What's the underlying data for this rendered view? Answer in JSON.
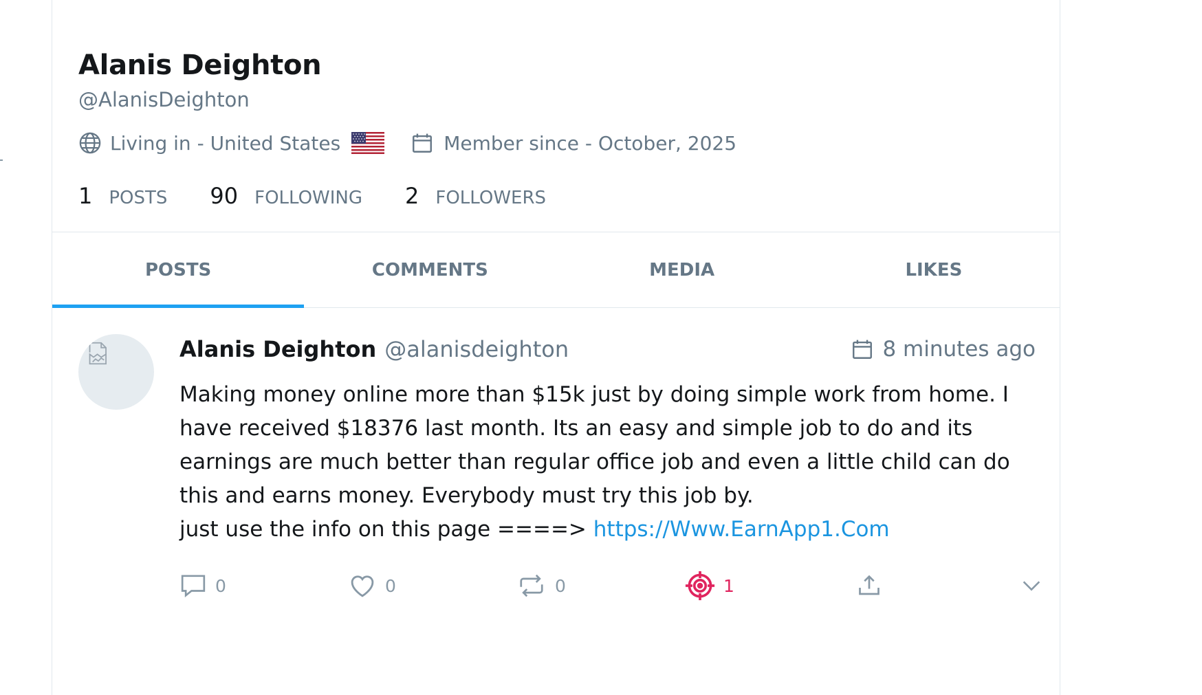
{
  "profile": {
    "name": "Alanis Deighton",
    "handle": "@AlanisDeighton",
    "location": "Living in - United States",
    "member_since": "Member since - October, 2025"
  },
  "stats": [
    {
      "value": "1",
      "label": "POSTS"
    },
    {
      "value": "90",
      "label": "FOLLOWING"
    },
    {
      "value": "2",
      "label": "FOLLOWERS"
    }
  ],
  "tabs": [
    {
      "label": "POSTS",
      "active": true
    },
    {
      "label": "COMMENTS",
      "active": false
    },
    {
      "label": "MEDIA",
      "active": false
    },
    {
      "label": "LIKES",
      "active": false
    }
  ],
  "post": {
    "author": "Alanis Deighton",
    "handle": "@alanisdeighton",
    "time": "8 minutes ago",
    "body": "Making money online more than $15k just by doing simple work from home. I have received $18376 last month. Its an easy and simple job to do and its earnings are much better than regular office job and even a little child can do this and earns money. Everybody must try this job by.",
    "cta": "just use the info on this page ====>",
    "link": "https://Www.EarnApp1.Com",
    "actions": {
      "comments": "0",
      "likes": "0",
      "reposts": "0",
      "reports": "1"
    }
  },
  "colors": {
    "accent": "#1da1f2",
    "link": "#1b95e0",
    "muted": "#657786",
    "alert": "#e0245e"
  },
  "icons": [
    "globe-icon",
    "us-flag-icon",
    "calendar-icon",
    "broken-image-icon",
    "comment-icon",
    "heart-icon",
    "repost-icon",
    "target-icon",
    "share-icon",
    "chevron-down-icon"
  ]
}
